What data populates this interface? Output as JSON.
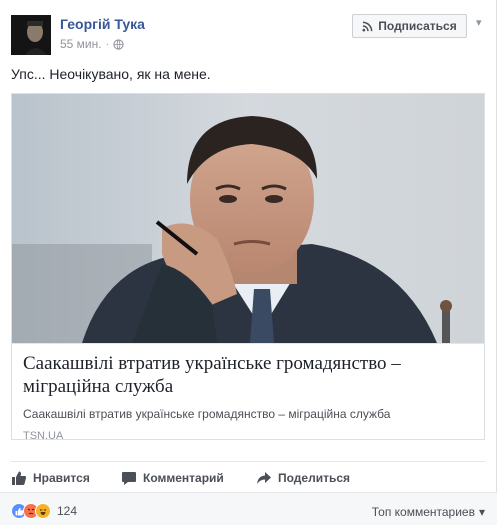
{
  "post": {
    "author": "Георгій Тука",
    "time": "55 мин.",
    "dot": "·",
    "subscribe_label": "Подписаться",
    "text": "Упс... Неочікувано, як на мене."
  },
  "link_card": {
    "title": "Саакашвілі втратив українське громадянство – міграційна служба",
    "description": "Саакашвілі втратив українське громадянство – міграційна служба",
    "domain": "TSN.UA"
  },
  "actions": {
    "like": "Нравится",
    "comment": "Комментарий",
    "share": "Поделиться"
  },
  "footer": {
    "reaction_count": "124",
    "sort_label": "Топ комментариев"
  },
  "icons": {
    "like": "thumbs-up-icon",
    "comment": "speech-bubble-icon",
    "share": "share-arrow-icon",
    "subscribe": "rss-icon",
    "privacy": "globe-icon",
    "reactions": [
      "like-reaction-icon",
      "angry-reaction-icon",
      "haha-reaction-icon"
    ]
  },
  "colors": {
    "link": "#365899",
    "secondary_text": "#90949c",
    "like_reaction": "#5890ff",
    "angry_reaction": "#f7714c",
    "haha_reaction": "#f7b125"
  }
}
